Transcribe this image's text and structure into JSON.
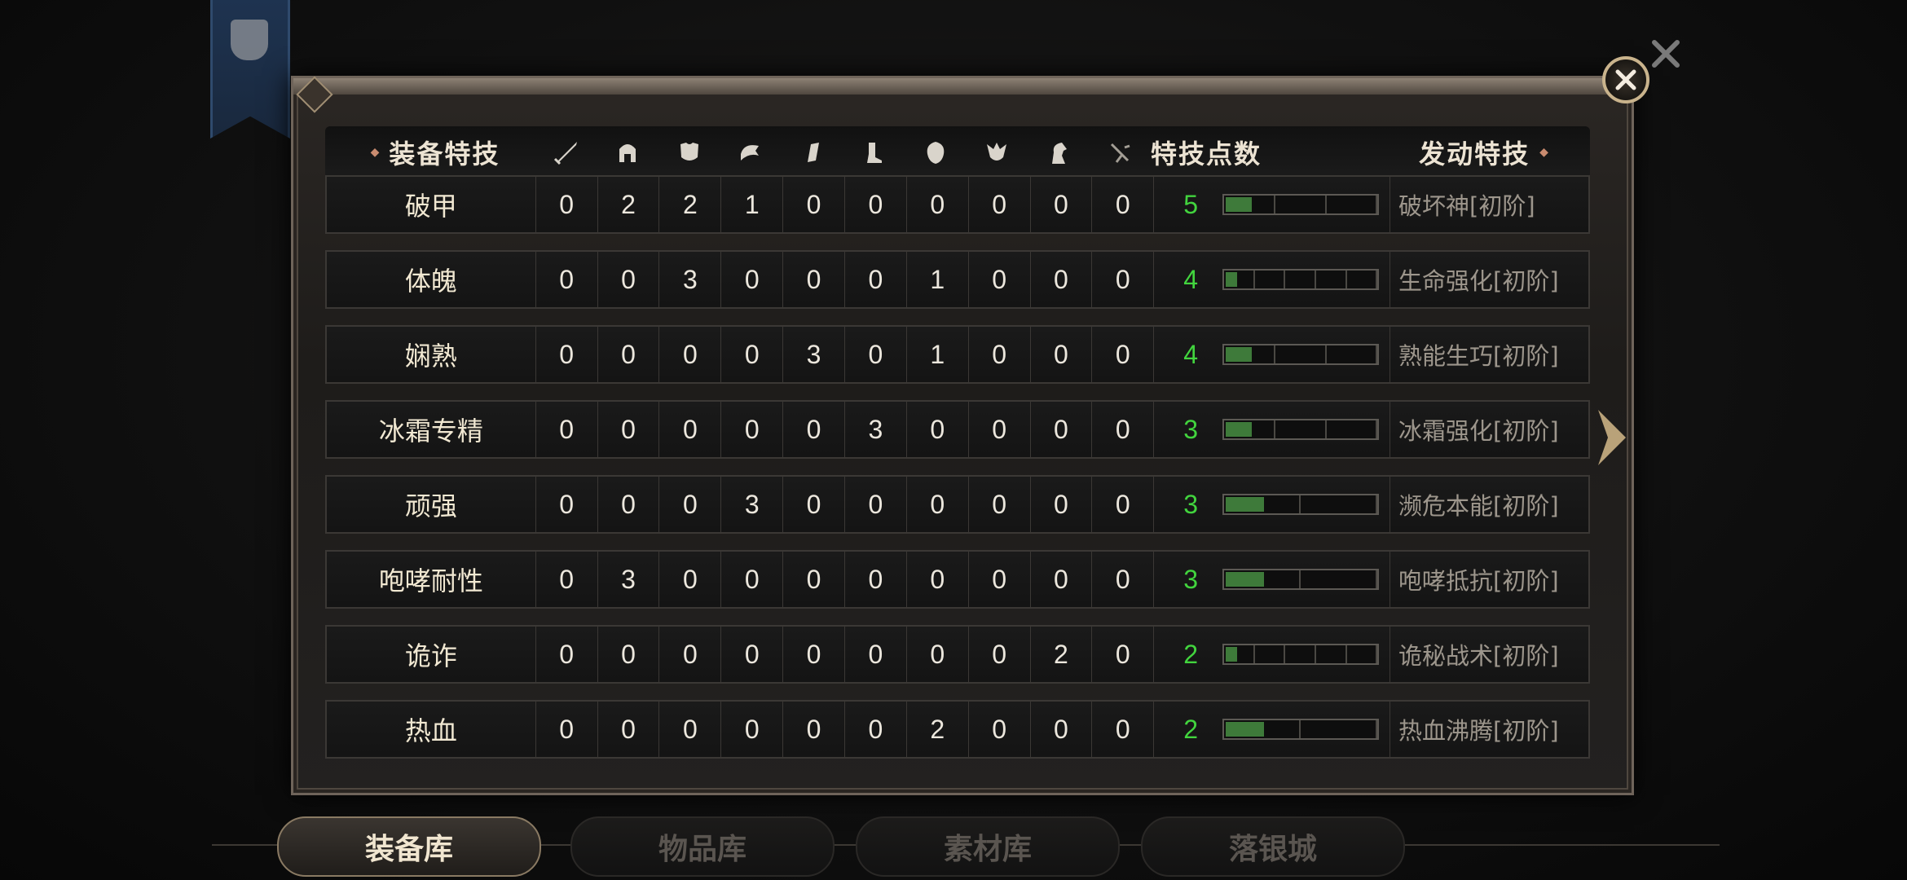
{
  "header": {
    "name_title": "装备特技",
    "stat_icons": [
      "sword-icon",
      "helmet-icon",
      "armor-icon",
      "pauldron-icon",
      "bracer-icon",
      "boots-icon",
      "shield-icon",
      "amulet-icon",
      "horse-icon",
      "accessory-icon"
    ],
    "points_title": "特技点数",
    "skill_title": "发动特技"
  },
  "rows": [
    {
      "name": "破甲",
      "stats": [
        "0",
        "2",
        "2",
        "1",
        "0",
        "0",
        "0",
        "0",
        "0",
        "0"
      ],
      "points": "5",
      "filled": 1,
      "segments": 3,
      "skill": "破坏神[初阶]"
    },
    {
      "name": "体魄",
      "stats": [
        "0",
        "0",
        "3",
        "0",
        "0",
        "0",
        "1",
        "0",
        "0",
        "0"
      ],
      "points": "4",
      "filled": 1,
      "segments": 5,
      "skill": "生命强化[初阶]"
    },
    {
      "name": "娴熟",
      "stats": [
        "0",
        "0",
        "0",
        "0",
        "3",
        "0",
        "1",
        "0",
        "0",
        "0"
      ],
      "points": "4",
      "filled": 1,
      "segments": 3,
      "skill": "熟能生巧[初阶]"
    },
    {
      "name": "冰霜专精",
      "stats": [
        "0",
        "0",
        "0",
        "0",
        "0",
        "3",
        "0",
        "0",
        "0",
        "0"
      ],
      "points": "3",
      "filled": 1,
      "segments": 3,
      "skill": "冰霜强化[初阶]"
    },
    {
      "name": "顽强",
      "stats": [
        "0",
        "0",
        "0",
        "3",
        "0",
        "0",
        "0",
        "0",
        "0",
        "0"
      ],
      "points": "3",
      "filled": 1,
      "segments": 2,
      "skill": "濒危本能[初阶]"
    },
    {
      "name": "咆哮耐性",
      "stats": [
        "0",
        "3",
        "0",
        "0",
        "0",
        "0",
        "0",
        "0",
        "0",
        "0"
      ],
      "points": "3",
      "filled": 1,
      "segments": 2,
      "skill": "咆哮抵抗[初阶]"
    },
    {
      "name": "诡诈",
      "stats": [
        "0",
        "0",
        "0",
        "0",
        "0",
        "0",
        "0",
        "0",
        "2",
        "0"
      ],
      "points": "2",
      "filled": 1,
      "segments": 5,
      "skill": "诡秘战术[初阶]"
    },
    {
      "name": "热血",
      "stats": [
        "0",
        "0",
        "0",
        "0",
        "0",
        "0",
        "2",
        "0",
        "0",
        "0"
      ],
      "points": "2",
      "filled": 1,
      "segments": 2,
      "skill": "热血沸腾[初阶]"
    }
  ],
  "tabs": [
    "装备库",
    "物品库",
    "素材库",
    "落银城"
  ],
  "active_tab": 0,
  "colors": {
    "points_green": "#42d43e",
    "bar_fill": "#3e7a3a",
    "accent_gold": "#c9b38c"
  }
}
